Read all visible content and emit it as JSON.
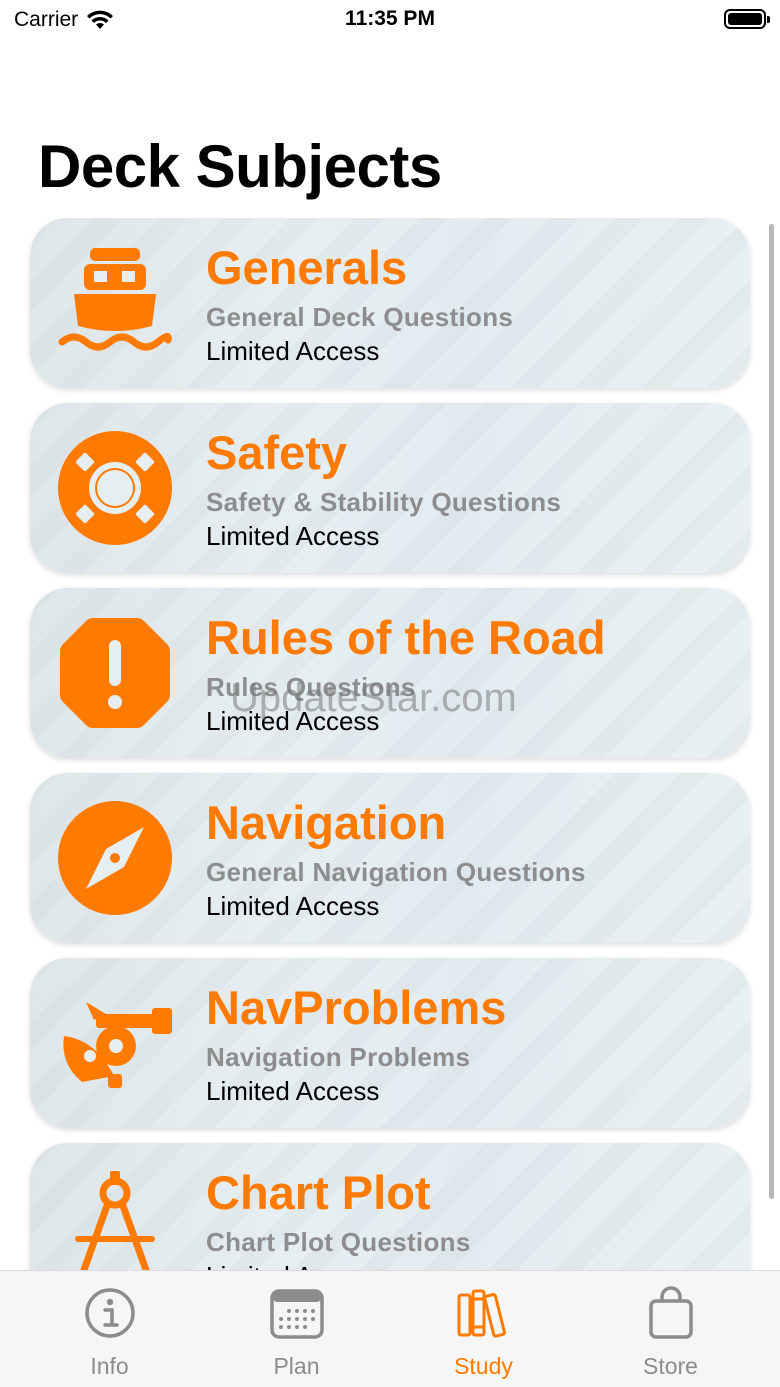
{
  "status": {
    "carrier": "Carrier",
    "time": "11:35 PM"
  },
  "header": {
    "title": "Deck Subjects"
  },
  "colors": {
    "accent": "#ff7a00",
    "subtitle": "#8d8d8d",
    "tab_inactive": "#8c8c8c"
  },
  "subjects": [
    {
      "title": "Generals",
      "subtitle": "General Deck Questions",
      "access": "Limited Access",
      "icon": "ferry-icon"
    },
    {
      "title": "Safety",
      "subtitle": "Safety & Stability Questions",
      "access": "Limited Access",
      "icon": "lifebuoy-icon"
    },
    {
      "title": "Rules of the Road",
      "subtitle": "Rules Questions",
      "access": "Limited Access",
      "icon": "exclamation-octagon-icon"
    },
    {
      "title": "Navigation",
      "subtitle": "General Navigation Questions",
      "access": "Limited Access",
      "icon": "compass-icon"
    },
    {
      "title": "NavProblems",
      "subtitle": "Navigation Problems",
      "access": "Limited Access",
      "icon": "sextant-icon"
    },
    {
      "title": "Chart Plot",
      "subtitle": "Chart Plot Questions",
      "access": "Limited Access",
      "icon": "drafting-compass-icon"
    }
  ],
  "watermark": "UpdateStar.com",
  "tabs": [
    {
      "label": "Info",
      "icon": "info-icon",
      "active": false
    },
    {
      "label": "Plan",
      "icon": "calendar-icon",
      "active": false
    },
    {
      "label": "Study",
      "icon": "books-icon",
      "active": true
    },
    {
      "label": "Store",
      "icon": "bag-icon",
      "active": false
    }
  ]
}
